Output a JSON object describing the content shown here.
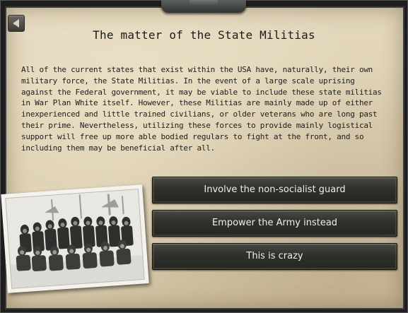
{
  "event": {
    "title": "The matter of the State Militias",
    "description": "All of the current states that exist within the USA have, naturally, their own military force, the State Militias. In the event of a large scale uprising against the Federal government, it may be viable to include these state militias in War Plan White itself. However, these Militias are mainly made up of either inexperienced and little trained civilians, or older veterans who are long past their prime. Nevertheless, utilizing these forces to provide mainly logistical support will free up more able bodied regulars to fight at the front, and so including them may be beneficial after all."
  },
  "options": [
    {
      "label": "Involve the non-socialist guard"
    },
    {
      "label": "Empower the Army instead"
    },
    {
      "label": "This is crazy"
    }
  ],
  "icons": {
    "back": "back-arrow-icon",
    "photo": "soldiers-group-photo"
  },
  "colors": {
    "paper": "#dccfb2",
    "button": "#2f2f2b",
    "button_text": "#f1efe8",
    "text": "#1e1e1e"
  }
}
